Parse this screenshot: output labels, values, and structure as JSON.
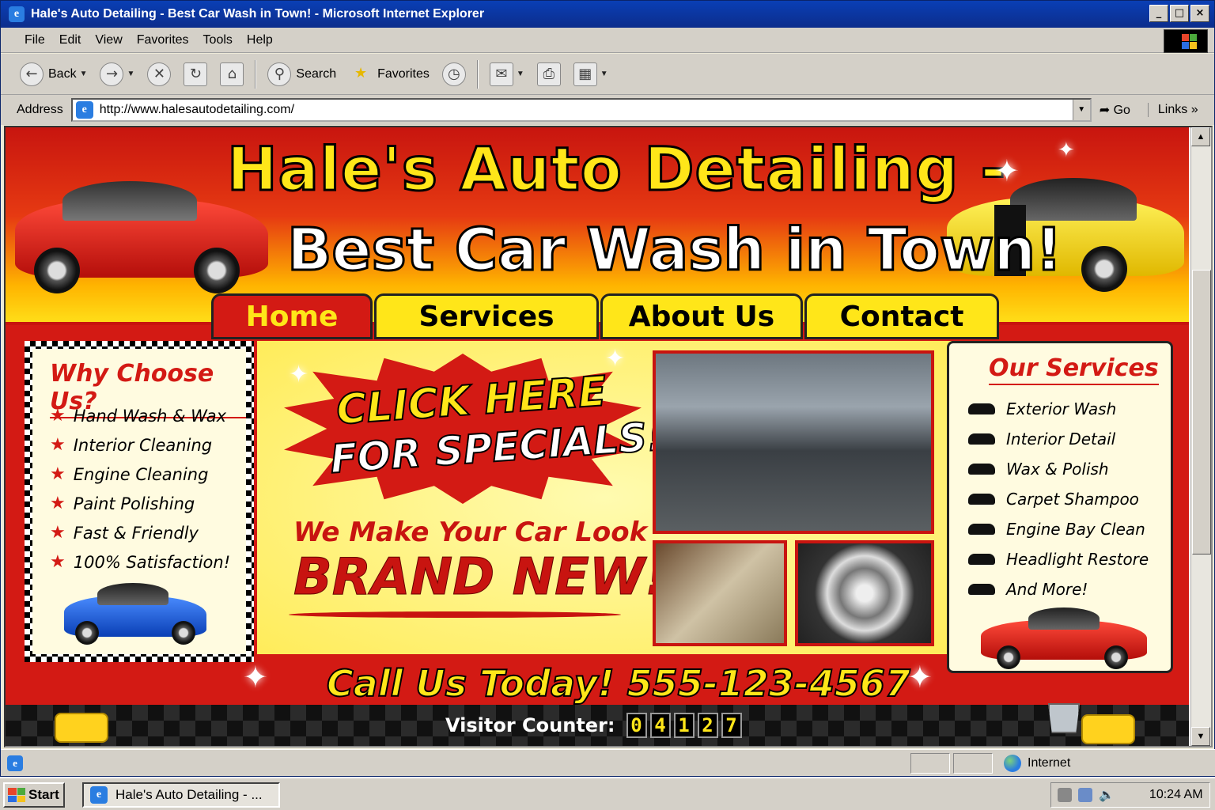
{
  "window": {
    "title": "Hale's Auto Detailing - Best Car Wash in Town! - Microsoft Internet Explorer",
    "buttons": [
      "_",
      "□",
      "×"
    ]
  },
  "menu": [
    "File",
    "Edit",
    "View",
    "Favorites",
    "Tools",
    "Help"
  ],
  "toolbar": {
    "back_label": "Back",
    "search_label": "Search",
    "favorites_label": "Favorites"
  },
  "address": {
    "label": "Address",
    "url": "http://www.halesautodetailing.com/",
    "go_label": "Go",
    "links_label": "Links"
  },
  "site": {
    "title_line1": "Hale's Auto Detailing -",
    "title_line2": "Best Car Wash in Town!",
    "nav": [
      "Home",
      "Services",
      "About Us",
      "Contact"
    ],
    "why": {
      "heading": "Why Choose Us?",
      "items": [
        "Hand Wash & Wax",
        "Interior Cleaning",
        "Engine Cleaning",
        "Paint Polishing",
        "Fast & Friendly",
        "100% Satisfaction!"
      ]
    },
    "specials": {
      "line1": "CLICK HERE",
      "line2": "FOR SPECIALS!"
    },
    "tagline1": "We Make Your Car Look",
    "tagline2": "BRAND NEW!",
    "services": {
      "heading": "Our Services",
      "items": [
        "Exterior Wash",
        "Interior Detail",
        "Wax & Polish",
        "Carpet Shampoo",
        "Engine Bay Clean",
        "Headlight Restore",
        "And More!"
      ]
    },
    "call": "Call Us Today!  555-123-4567",
    "counter": {
      "label": "Visitor Counter:",
      "digits": [
        "0",
        "4",
        "1",
        "2",
        "7"
      ]
    }
  },
  "status": {
    "zone": "Internet"
  },
  "taskbar": {
    "start": "Start",
    "task": "Hale's Auto Detailing - ...",
    "clock": "10:24 AM"
  },
  "colors": {
    "brand_red": "#d31a14",
    "brand_yellow": "#ffe619",
    "titlebar_blue": "#0a3fb5"
  }
}
